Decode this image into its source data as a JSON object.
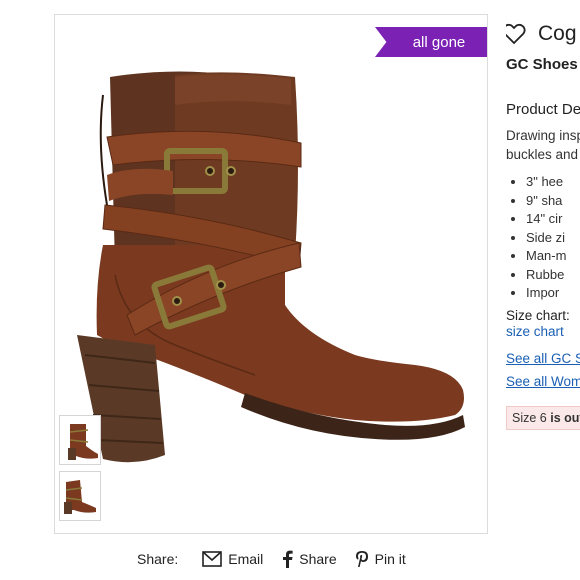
{
  "badge": {
    "label": "all gone",
    "color": "#7b22b5"
  },
  "product": {
    "title": "Cog",
    "brand": "GC Shoes",
    "details_heading": "Product De",
    "description_lines": [
      "Drawing insp",
      "buckles and"
    ],
    "features": [
      "3\" hee",
      "9\" sha",
      "14\" cir",
      "Side zi",
      "Man-m",
      "Rubbe",
      "Impor"
    ],
    "size_chart_label": "Size chart:",
    "size_chart_link": "size chart",
    "see_all_brand": "See all GC S",
    "see_all_category": "See all Wom",
    "size_alert_prefix": "Size 6 ",
    "size_alert_bold": "is out"
  },
  "share": {
    "label": "Share:",
    "email": "Email",
    "facebook": "Share",
    "pinterest": "Pin it"
  },
  "icons": {
    "favorite": "heart-outline-icon",
    "email": "envelope-icon",
    "facebook": "facebook-icon",
    "pinterest": "pinterest-icon"
  }
}
